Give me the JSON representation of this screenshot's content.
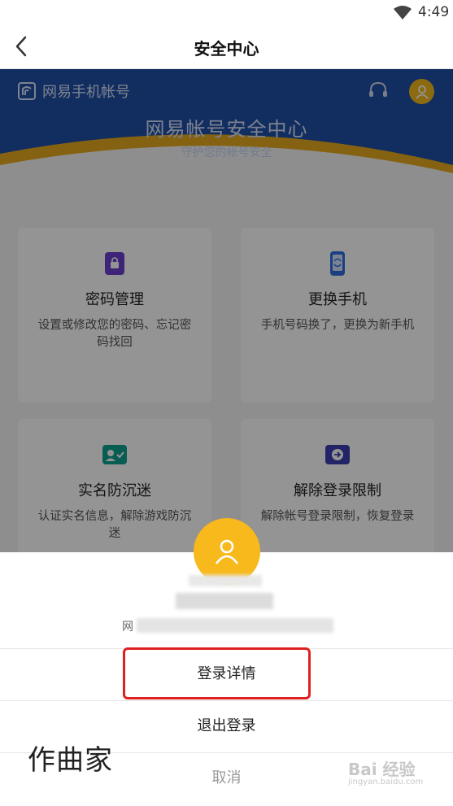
{
  "status_bar": {
    "time": "4:49"
  },
  "header": {
    "title": "安全中心"
  },
  "banner": {
    "brand": "网易手机帐号",
    "title": "网易帐号安全中心",
    "subtitle": "守护您的帐号安全",
    "colors": {
      "blue": "#1f4fa6",
      "gold": "#e3a91e"
    }
  },
  "cards": [
    {
      "title": "密码管理",
      "desc": "设置或修改您的密码、忘记密码找回",
      "icon": "lock-icon",
      "color": "#6a3fd1"
    },
    {
      "title": "更换手机",
      "desc": "手机号码换了，更换为新手机",
      "icon": "phone-swap-icon",
      "color": "#2f6fe0"
    },
    {
      "title": "实名防沉迷",
      "desc": "认证实名信息，解除游戏防沉迷",
      "icon": "id-card-icon",
      "color": "#0fa090"
    },
    {
      "title": "解除登录限制",
      "desc": "解除帐号登录限制，恢复登录",
      "icon": "unlock-arrow-icon",
      "color": "#3d3fb3"
    }
  ],
  "sheet": {
    "account_prefix": "网",
    "login_details": "登录详情",
    "logout": "退出登录",
    "cancel": "取消",
    "avatar_color": "#f7b91c"
  },
  "watermarks": {
    "left": "作曲家",
    "right": "Bai 经验",
    "url": "jingyan.baidu.com"
  }
}
